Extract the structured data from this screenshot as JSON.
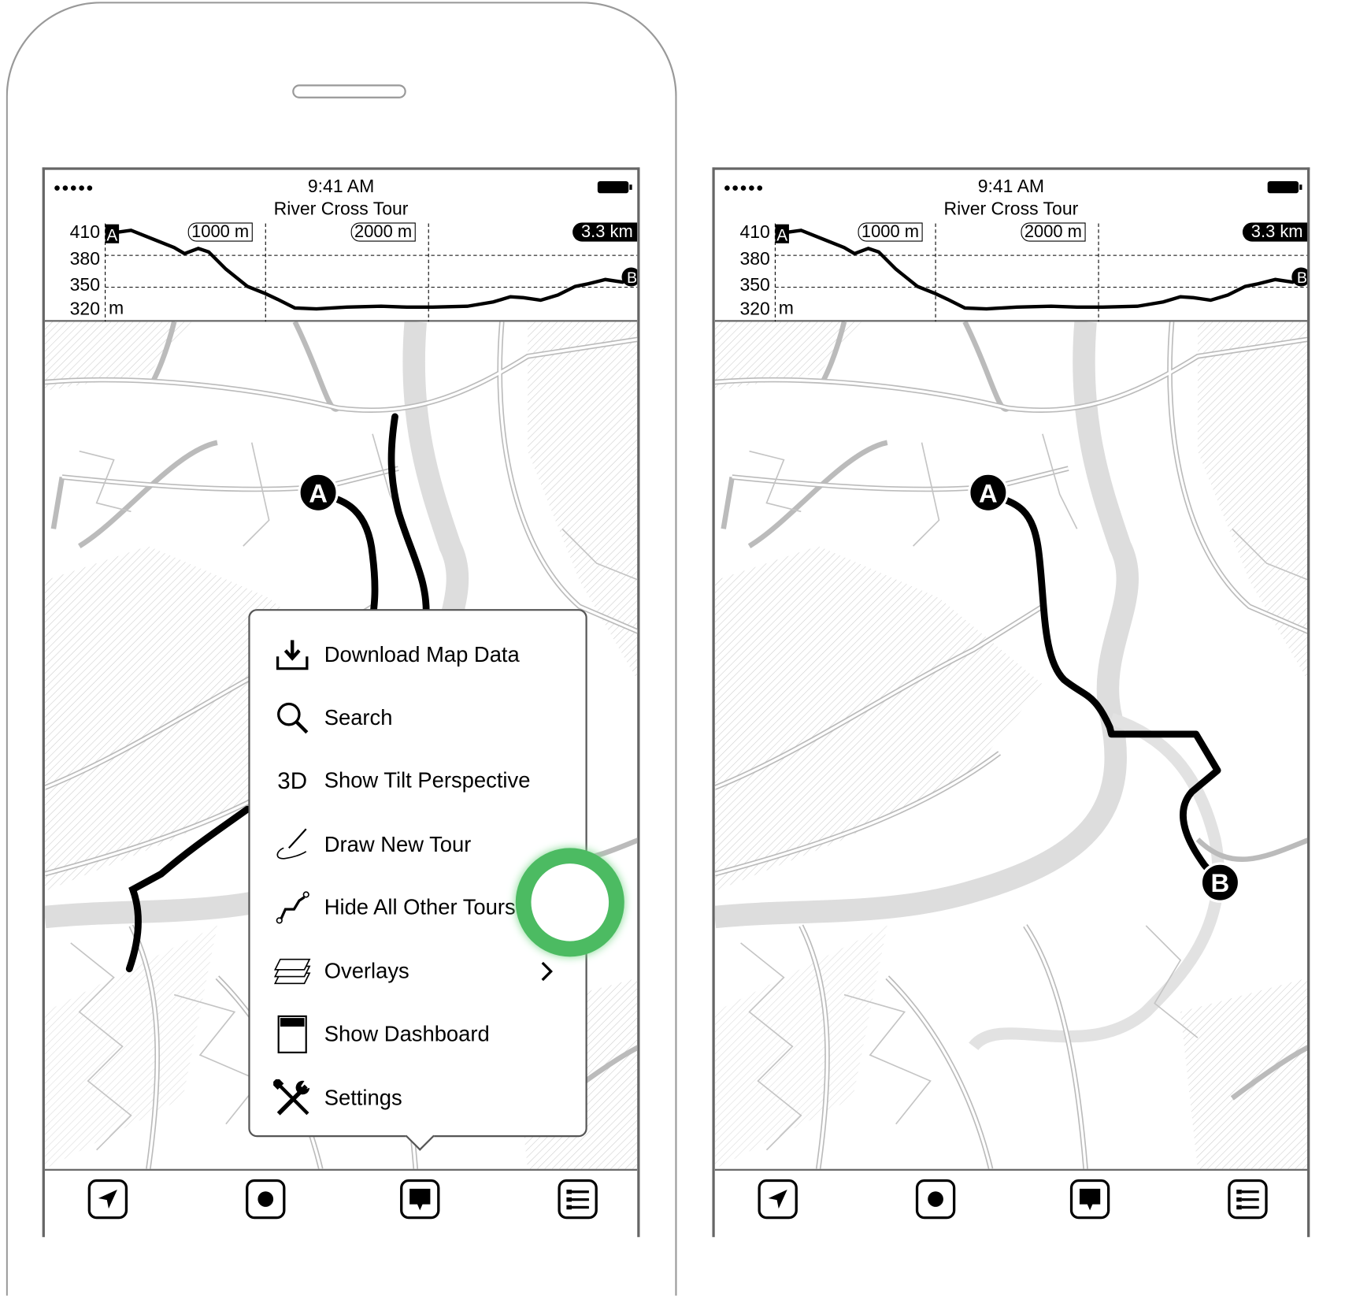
{
  "status_bar": {
    "signal": "●●●●●",
    "time": "9:41 AM"
  },
  "tour": {
    "title": "River Cross Tour",
    "total_distance": "3.3 km",
    "start_marker": "A",
    "end_marker": "B"
  },
  "elevation": {
    "y_labels": [
      "410",
      "380",
      "350",
      "320"
    ],
    "unit": "m",
    "distance_markers": [
      "1000 m",
      "2000 m"
    ]
  },
  "menu": {
    "items": [
      {
        "label": "Download Map Data",
        "icon": "download-icon"
      },
      {
        "label": "Search",
        "icon": "search-icon"
      },
      {
        "label": "Show Tilt Perspective",
        "icon": "3d-icon",
        "icon_text": "3D"
      },
      {
        "label": "Draw New Tour",
        "icon": "draw-icon"
      },
      {
        "label": "Hide All Other Tours",
        "icon": "route-icon"
      },
      {
        "label": "Overlays",
        "icon": "layers-icon",
        "has_submenu": true
      },
      {
        "label": "Show Dashboard",
        "icon": "dashboard-icon"
      },
      {
        "label": "Settings",
        "icon": "settings-icon"
      }
    ]
  },
  "tabbar": {
    "items": [
      "location-arrow-icon",
      "record-icon",
      "menu-bubble-icon",
      "list-icon"
    ]
  },
  "colors": {
    "tap_indicator": "#4cbb62",
    "route": "#000000",
    "roads": "#bbbbbb"
  }
}
